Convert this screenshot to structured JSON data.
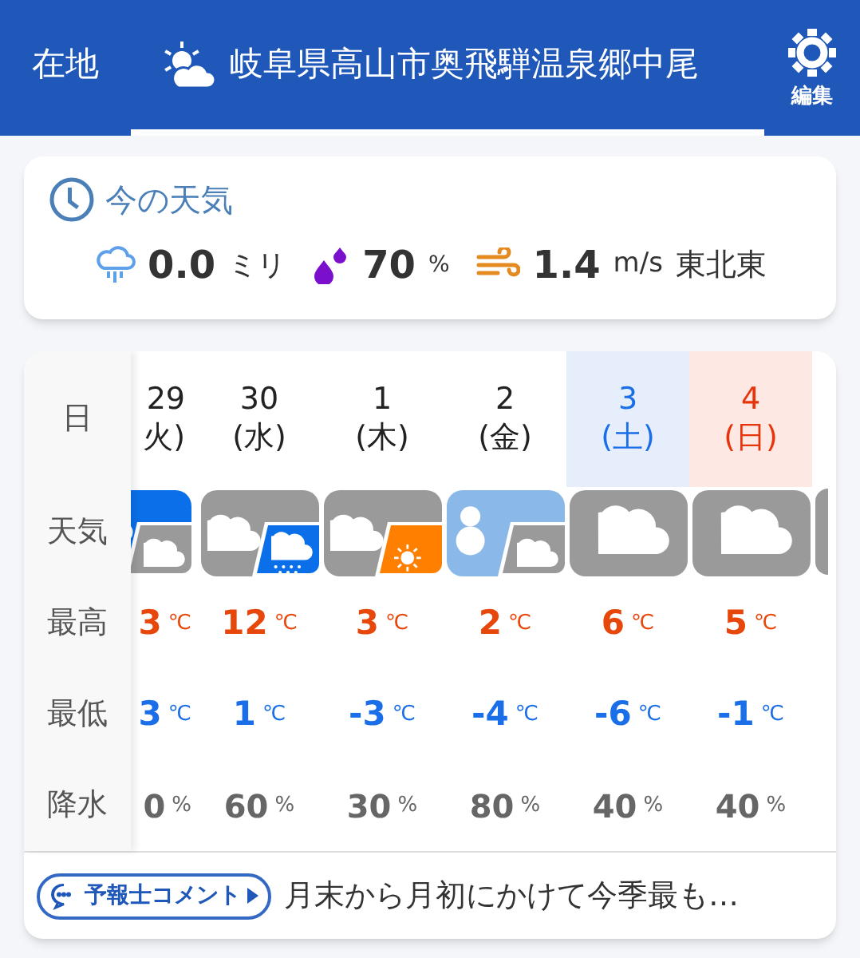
{
  "header": {
    "tabs": [
      {
        "label": "在地",
        "selected": false
      },
      {
        "label": "岐阜県高山市奥飛騨温泉郷中尾",
        "selected": true
      }
    ],
    "edit_label": "編集"
  },
  "current": {
    "title": "今の天気",
    "rain_value": "0.0",
    "rain_unit": "ミリ",
    "humidity_value": "70",
    "humidity_unit": "%",
    "wind_value": "1.4",
    "wind_unit": "m/s",
    "wind_direction": "東北東"
  },
  "forecast": {
    "row_labels": [
      "日",
      "天気",
      "最高",
      "最低",
      "降水"
    ],
    "days": [
      {
        "date": "29",
        "weekday": "火)",
        "kind": "weekday",
        "weather": [
          {
            "kind": "rain"
          },
          {
            "kind": "cloudy"
          }
        ],
        "high": "3",
        "high_unit": "℃",
        "low": "3",
        "low_unit": "℃",
        "precip": "0",
        "precip_unit": "%"
      },
      {
        "date": "30",
        "weekday": "(水)",
        "kind": "weekday",
        "weather": [
          {
            "kind": "cloudy"
          },
          {
            "kind": "rain"
          }
        ],
        "high": "12",
        "high_unit": "℃",
        "low": "1",
        "low_unit": "℃",
        "precip": "60",
        "precip_unit": "%"
      },
      {
        "date": "1",
        "weekday": "(木)",
        "kind": "weekday",
        "weather": [
          {
            "kind": "cloudy"
          },
          {
            "kind": "sunny"
          }
        ],
        "high": "3",
        "high_unit": "℃",
        "low": "-3",
        "low_unit": "℃",
        "precip": "30",
        "precip_unit": "%"
      },
      {
        "date": "2",
        "weekday": "(金)",
        "kind": "weekday",
        "weather": [
          {
            "kind": "snow"
          },
          {
            "kind": "cloudy"
          }
        ],
        "high": "2",
        "high_unit": "℃",
        "low": "-4",
        "low_unit": "℃",
        "precip": "80",
        "precip_unit": "%"
      },
      {
        "date": "3",
        "weekday": "(土)",
        "kind": "saturday",
        "weather": [
          {
            "kind": "cloudy"
          }
        ],
        "high": "6",
        "high_unit": "℃",
        "low": "-6",
        "low_unit": "℃",
        "precip": "40",
        "precip_unit": "%"
      },
      {
        "date": "4",
        "weekday": "(日)",
        "kind": "sunday",
        "weather": [
          {
            "kind": "cloudy"
          }
        ],
        "high": "5",
        "high_unit": "℃",
        "low": "-1",
        "low_unit": "℃",
        "precip": "40",
        "precip_unit": "%"
      }
    ]
  },
  "comment": {
    "button": "予報士コメント",
    "text": "月末から月初にかけて今季最も…"
  }
}
